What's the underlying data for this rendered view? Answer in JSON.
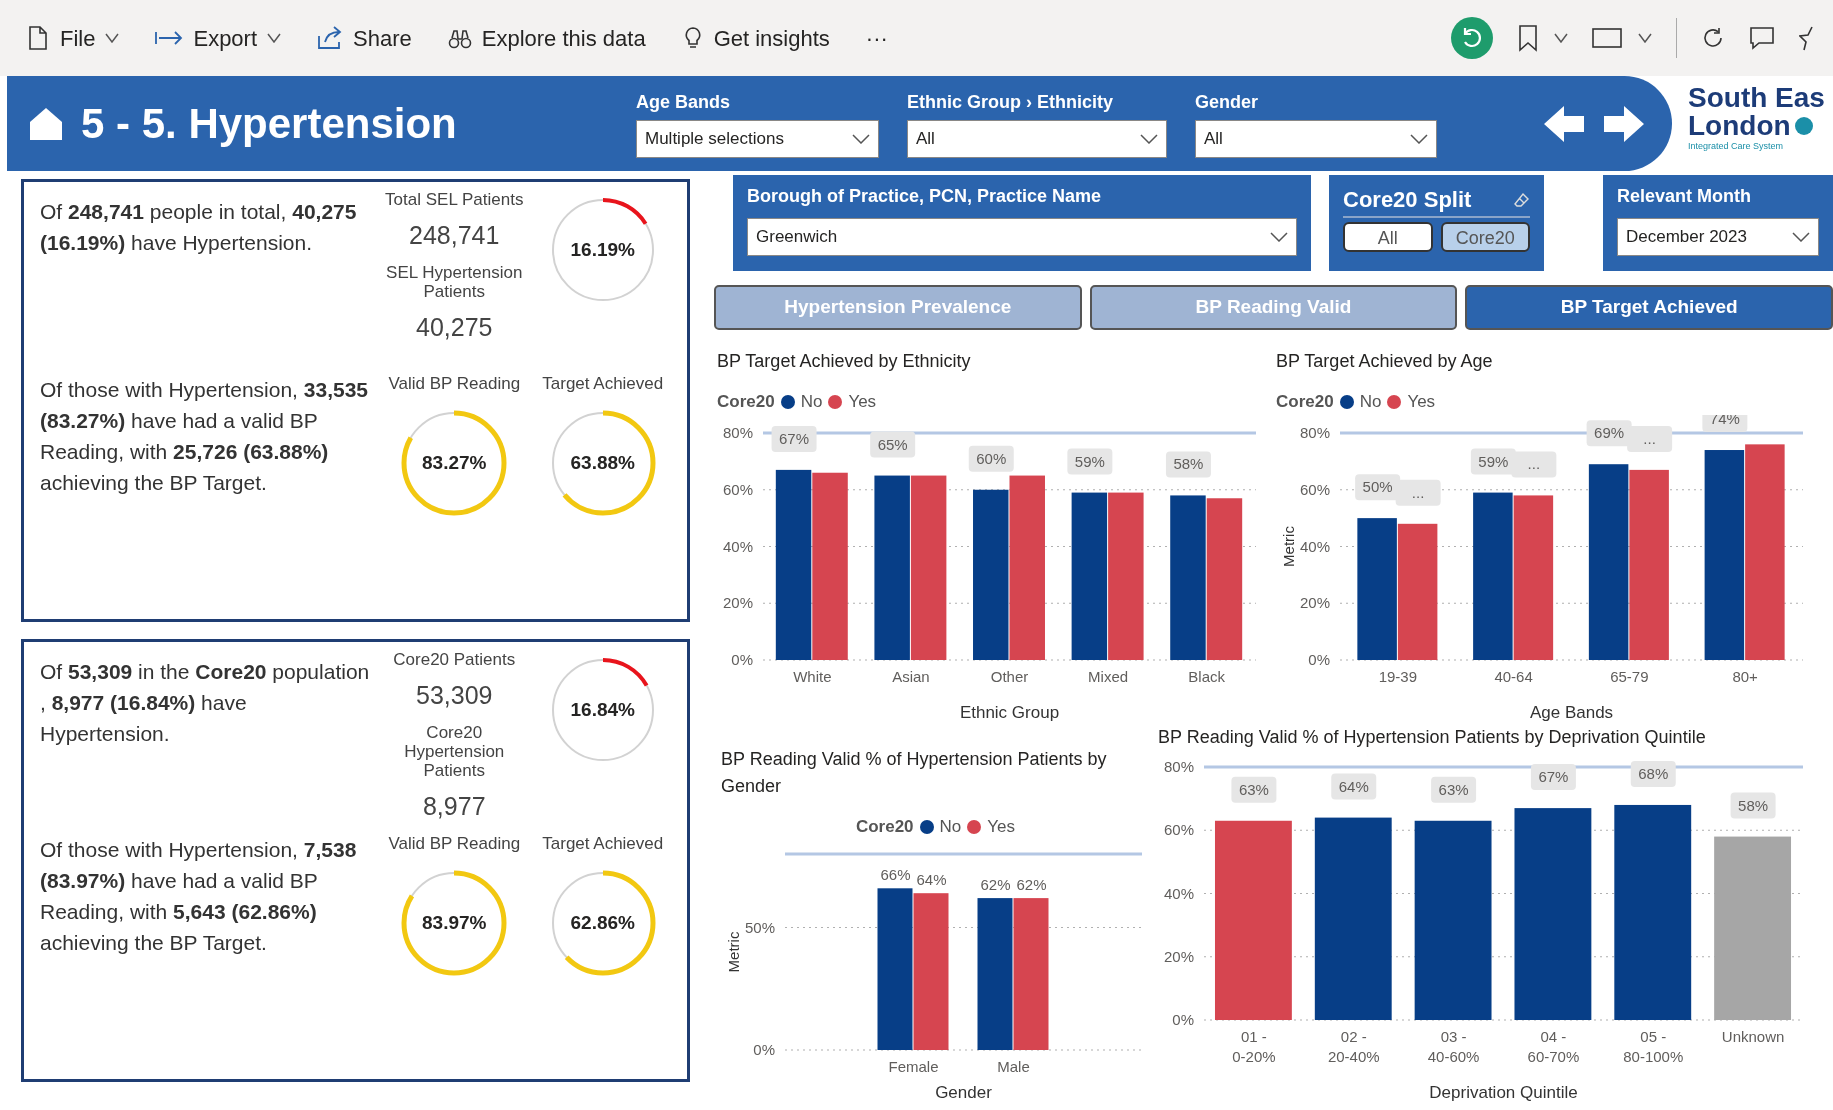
{
  "toolbar": {
    "items": [
      {
        "label": "File",
        "kind": "menu"
      },
      {
        "label": "Export",
        "kind": "menu"
      },
      {
        "label": "Share",
        "kind": "action"
      },
      {
        "label": "Explore this data",
        "kind": "action"
      },
      {
        "label": "Get insights",
        "kind": "action"
      }
    ],
    "more": "···"
  },
  "header": {
    "title": "5 - 5. Hypertension",
    "slicers": [
      {
        "label": "Age Bands",
        "value": "Multiple selections"
      },
      {
        "label": "Ethnic Group › Ethnicity",
        "value": "All"
      },
      {
        "label": "Gender",
        "value": "All"
      }
    ],
    "logo": {
      "line1": "South Eas",
      "line2": "London",
      "tagline": "Integrated Care System"
    }
  },
  "summary_cards": [
    {
      "intro": "Of **248,741** people in total, **40,275 (16.19%)** have Hypertension.",
      "detail": "Of those with Hypertension, **33,535 (83.27%)** have had a valid BP Reading, with **25,726 (63.88%)** achieving the BP Target.",
      "stats": [
        {
          "label": "Total SEL Patients",
          "value": "248,741"
        },
        {
          "label": "SEL Hypertension Patients",
          "value": "40,275"
        }
      ],
      "prevalence": {
        "reading": "16.19%",
        "level": 0.1619
      },
      "gauges": [
        {
          "label": "Valid BP Reading",
          "reading": "83.27%",
          "level": 0.8327
        },
        {
          "label": "Target Achieved",
          "reading": "63.88%",
          "level": 0.6388
        }
      ]
    },
    {
      "intro": "Of **53,309** in the **Core20** population , **8,977 (16.84%)** have Hypertension.",
      "detail": "Of those with Hypertension, **7,538 (83.97%)** have had a valid BP Reading, with **5,643 (62.86%)** achieving the BP Target.",
      "stats": [
        {
          "label": "Core20 Patients",
          "value": "53,309"
        },
        {
          "label": "Core20 Hypertension Patients",
          "value": "8,977"
        }
      ],
      "prevalence": {
        "reading": "16.84%",
        "level": 0.1684
      },
      "gauges": [
        {
          "label": "Valid BP Reading",
          "reading": "83.97%",
          "level": 0.8397
        },
        {
          "label": "Target Achieved",
          "reading": "62.86%",
          "level": 0.6286
        }
      ]
    }
  ],
  "filters": {
    "borough": {
      "label": "Borough of Practice, PCN, Practice Name",
      "value": "Greenwich"
    },
    "core20_split": {
      "label": "Core20 Split",
      "options": [
        {
          "label": "All",
          "selected": false
        },
        {
          "label": "Core20",
          "selected": true
        }
      ]
    },
    "month": {
      "label": "Relevant Month",
      "value": "December 2023"
    }
  },
  "tabs": [
    {
      "label": "Hypertension Prevalence",
      "selected": false
    },
    {
      "label": "BP Reading Valid",
      "selected": false
    },
    {
      "label": "BP Target Achieved",
      "selected": true
    }
  ],
  "charts": [
    {
      "chart_data": {
        "type": "bar",
        "title": "BP Target Achieved by Ethnicity",
        "xlabel": "Ethnic Group",
        "legend_title": "Core20",
        "grid": true,
        "categories": [
          "White",
          "Asian",
          "Other",
          "Mixed",
          "Black"
        ],
        "series": [
          {
            "name": "No",
            "color": "#073e87",
            "values": [
              67,
              65,
              60,
              59,
              58
            ]
          },
          {
            "name": "Yes",
            "color": "#d64550",
            "values": [
              66,
              65,
              65,
              59,
              57
            ]
          }
        ],
        "value_labels": [
          [
            "67%",
            "65%",
            "60%",
            "59%",
            "58%"
          ],
          [
            null,
            null,
            null,
            null,
            null
          ]
        ],
        "ylim": [
          0,
          80
        ],
        "yticks": [
          {
            "value": 0,
            "label": "0%"
          },
          {
            "value": 20,
            "label": "20%"
          },
          {
            "value": 40,
            "label": "40%"
          },
          {
            "value": 60,
            "label": "60%"
          },
          {
            "value": 80,
            "label": "80%"
          }
        ]
      }
    },
    {
      "chart_data": {
        "type": "bar",
        "title": "BP Target Achieved by Age",
        "xlabel": "Age Bands",
        "ylabel": "Metric",
        "legend_title": "Core20",
        "grid": true,
        "categories": [
          "19-39",
          "40-64",
          "65-79",
          "80+"
        ],
        "series": [
          {
            "name": "No",
            "color": "#073e87",
            "values": [
              50,
              59,
              69,
              74
            ]
          },
          {
            "name": "Yes",
            "color": "#d64550",
            "values": [
              48,
              58,
              67,
              76
            ]
          }
        ],
        "value_labels": [
          [
            "50%",
            "59%",
            "69%",
            "74%"
          ],
          [
            "...",
            "...",
            "...",
            null
          ]
        ],
        "ylim": [
          0,
          80
        ],
        "yticks": [
          {
            "value": 0,
            "label": "0%"
          },
          {
            "value": 20,
            "label": "20%"
          },
          {
            "value": 40,
            "label": "40%"
          },
          {
            "value": 60,
            "label": "60%"
          },
          {
            "value": 80,
            "label": "80%"
          }
        ]
      }
    },
    {
      "chart_data": {
        "type": "bar",
        "title": "BP Reading Valid % of Hypertension Patients by Gender",
        "xlabel": "Gender",
        "ylabel": "Metric",
        "legend_title": "Core20",
        "grid": true,
        "categories": [
          "Female",
          "Male"
        ],
        "series": [
          {
            "name": "No",
            "color": "#073e87",
            "values": [
              66,
              62
            ]
          },
          {
            "name": "Yes",
            "color": "#d64550",
            "values": [
              64,
              62
            ]
          }
        ],
        "value_labels": [
          [
            "66%",
            "62%"
          ],
          [
            "64%",
            "62%"
          ]
        ],
        "ylim": [
          0,
          80
        ],
        "yticks": [
          {
            "value": 0,
            "label": "0%"
          },
          {
            "value": 50,
            "label": "50%"
          }
        ]
      }
    },
    {
      "chart_data": {
        "type": "bar",
        "title": "BP Reading Valid % of Hypertension Patients by Deprivation Quintile",
        "xlabel": "Deprivation Quintile",
        "grid": true,
        "categories": [
          "01 - 0-20%",
          "02 - 20-40%",
          "03 - 40-60%",
          "04 - 60-70%",
          "05 - 80-100%",
          "Unknown"
        ],
        "values": [
          63,
          64,
          63,
          67,
          68,
          58
        ],
        "colors": [
          "#d64550",
          "#073e87",
          "#073e87",
          "#073e87",
          "#073e87",
          "#a6a6a6"
        ],
        "value_labels": [
          "63%",
          "64%",
          "63%",
          "67%",
          "68%",
          "58%"
        ],
        "ylim": [
          0,
          80
        ],
        "yticks": [
          {
            "value": 0,
            "label": "0%"
          },
          {
            "value": 20,
            "label": "20%"
          },
          {
            "value": 40,
            "label": "40%"
          },
          {
            "value": 60,
            "label": "60%"
          },
          {
            "value": 80,
            "label": "80%"
          }
        ]
      }
    }
  ]
}
